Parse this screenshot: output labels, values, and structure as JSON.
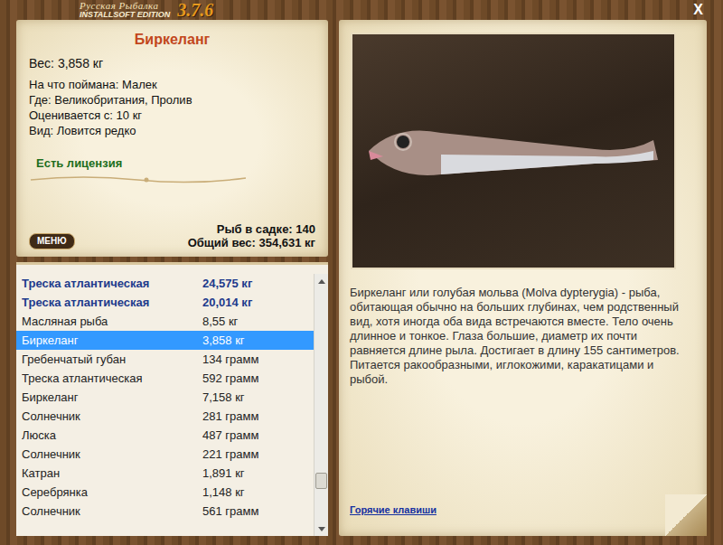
{
  "window": {
    "brand": "Русская Рыбалка",
    "edition": "INSTALLSOFT EDITION",
    "version": "3.7.6",
    "close": "X"
  },
  "fish": {
    "name": "Биркеланг",
    "weight": "Вес: 3,858 кг",
    "details": [
      "На что поймана: Малек",
      "Где: Великобритания, Пролив",
      "Оценивается с: 10 кг",
      "Вид: Ловится редко"
    ],
    "license": "Есть лицензия"
  },
  "keepnet": {
    "count": "Рыб в садке: 140",
    "total": "Общий вес: 354,631 кг"
  },
  "menu_button": "МЕНЮ",
  "catch_list": [
    {
      "name": "Треска атлантическая",
      "weight": "24,575 кг",
      "kind": "trophy",
      "selected": false
    },
    {
      "name": "Треска атлантическая",
      "weight": "20,014 кг",
      "kind": "trophy",
      "selected": false
    },
    {
      "name": "Масляная рыба",
      "weight": "8,55 кг",
      "kind": "regular",
      "selected": false
    },
    {
      "name": "Биркеланг",
      "weight": "3,858 кг",
      "kind": "regular",
      "selected": true
    },
    {
      "name": "Гребенчатый губан",
      "weight": "134 грамм",
      "kind": "regular",
      "selected": false
    },
    {
      "name": "Треска атлантическая",
      "weight": "592 грамм",
      "kind": "regular",
      "selected": false
    },
    {
      "name": "Биркеланг",
      "weight": "7,158 кг",
      "kind": "regular",
      "selected": false
    },
    {
      "name": "Солнечник",
      "weight": "281 грамм",
      "kind": "regular",
      "selected": false
    },
    {
      "name": "Люска",
      "weight": "487 грамм",
      "kind": "regular",
      "selected": false
    },
    {
      "name": "Солнечник",
      "weight": "221 грамм",
      "kind": "regular",
      "selected": false
    },
    {
      "name": "Катран",
      "weight": "1,891 кг",
      "kind": "regular",
      "selected": false
    },
    {
      "name": "Серебрянка",
      "weight": "1,148 кг",
      "kind": "regular",
      "selected": false
    },
    {
      "name": "Солнечник",
      "weight": "561 грамм",
      "kind": "regular",
      "selected": false
    }
  ],
  "scrollbar": {
    "level": 0.85
  },
  "description": "Биркеланг или голубая мольва (Molva dypterygia) - рыба, обитающая обычно на больших глубинах, чем родственный вид, хотя иногда оба вида встречаются вместе. Тело очень длинное и тонкое. Глаза большие, диаметр их почти равняется длине рыла. Достигает в длину 155 сантиметров. Питается ракообразными, иглокожими, каракатицами и рыбой.",
  "hotkeys": "Горячие клавиши"
}
